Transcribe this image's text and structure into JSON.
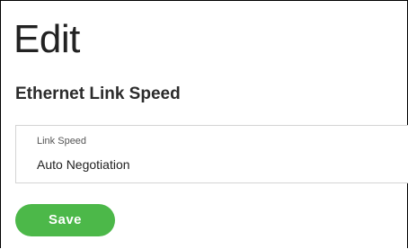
{
  "page": {
    "title": "Edit"
  },
  "section": {
    "title": "Ethernet Link Speed"
  },
  "link_speed_field": {
    "label": "Link Speed",
    "value": "Auto Negotiation"
  },
  "actions": {
    "save_label": "Save"
  },
  "colors": {
    "save_button": "#4cb849",
    "border": "#d4d4d4"
  }
}
